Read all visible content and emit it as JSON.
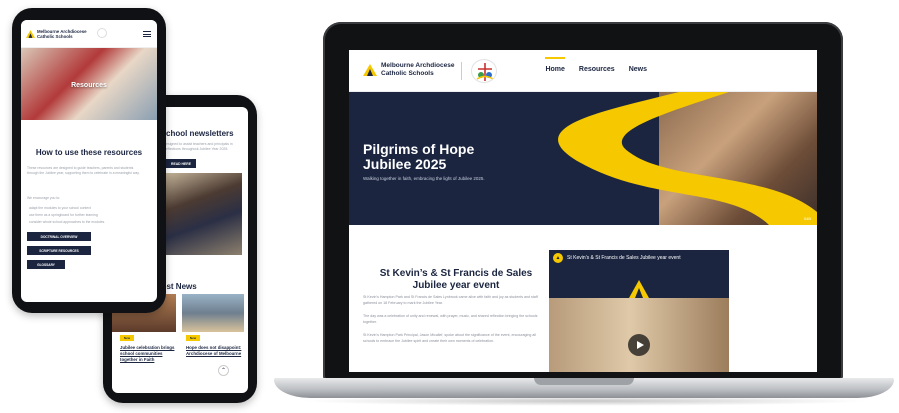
{
  "laptop": {
    "logo_line1": "Melbourne Archdiocese",
    "logo_line2": "Catholic Schools",
    "nav": [
      "Home",
      "Resources",
      "News"
    ],
    "hero_title_line1": "Pilgrims of Hope",
    "hero_title_line2": "Jubilee 2025",
    "hero_sub": "Walking together in faith, embracing the light of Jubilee 2025.",
    "hero_credit": "04B",
    "event_title_line1": "St Kevin’s & St Francis de Sales",
    "event_title_line2": "Jubilee year event",
    "paragraphs": [
      "St Kevin’s Hampton Park and St Francis de Sales Lynbrook came alive with faith and joy as students and staff gathered on 18 February to mark the Jubilee Year.",
      "The day was a celebration of unity and renewal, with prayer, music, and shared reflection bringing the schools together.",
      "St Kevin’s Hampton Park Principal, Jason Micallef, spoke about the significance of the event, encouraging all schools to embrace the Jubilee spirit and create their own moments of celebration."
    ],
    "video_title": "St Kevin’s & St Francis de Sales Jubilee year event"
  },
  "phone_back": {
    "title": "chool newsletters",
    "text": "esigned to assist teachers and principals in eflections throughout Jubilee Year 2025.",
    "button": "READ HERE",
    "latest_title": "est News",
    "tag": "New",
    "news1": "Jubilee celebration brings school communities together in Faith",
    "news2": "Hope does not disappoint: Archdiocese of Melbourne",
    "up_arrow": "⌃"
  },
  "phone_front": {
    "logo_line1": "Melbourne Archdiocese",
    "logo_line2": "Catholic Schools",
    "hero_title": "Resources",
    "section_title": "How to use these resources",
    "intro": "These resources are designed to guide teachers, parents and students through the Jubilee year, supporting them to celebrate in a meaningful way.",
    "encourage": "We encourage you to:",
    "bullets": [
      "adapt the modules to your school context",
      "use them as a springboard for further learning",
      "consider whole school approaches to the modules."
    ],
    "buttons": [
      "DOCTRINAL OVERVIEW",
      "SCRIPTURE RESOURCES",
      "GLOSSARY"
    ]
  },
  "colors": {
    "navy": "#1b2540",
    "yellow": "#f5c800"
  }
}
